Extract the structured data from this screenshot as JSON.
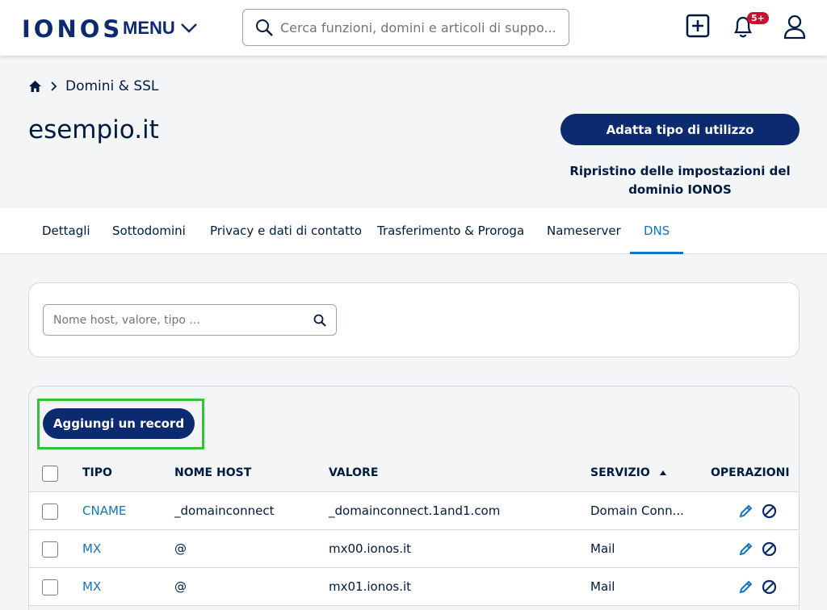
{
  "header": {
    "logo": "IONOS",
    "menu_label": "MENU",
    "search_placeholder": "Cerca funzioni, domini e articoli di suppo...",
    "notifications_badge": "5+"
  },
  "breadcrumb": {
    "label": "Domini & SSL"
  },
  "page": {
    "title": "esempio.it",
    "primary_button": "Adatta tipo di utilizzo",
    "reset_link_line1": "Ripristino delle impostazioni del",
    "reset_link_line2": "dominio IONOS"
  },
  "tabs": [
    {
      "label": "Dettagli"
    },
    {
      "label": "Sottodomini"
    },
    {
      "label": "Privacy e dati di contatto"
    },
    {
      "label": "Trasferimento & Proroga"
    },
    {
      "label": "Nameserver"
    },
    {
      "label": "DNS"
    }
  ],
  "filter": {
    "placeholder": "Nome host, valore, tipo ..."
  },
  "records": {
    "add_button": "Aggiungi un record",
    "columns": {
      "tipo": "TIPO",
      "nome_host": "NOME HOST",
      "valore": "VALORE",
      "servizio": "SERVIZIO",
      "operazioni": "OPERAZIONI"
    },
    "rows": [
      {
        "tipo": "CNAME",
        "host": "_domainconnect",
        "valore": "_domainconnect.1and1.com",
        "servizio": "Domain Conn..."
      },
      {
        "tipo": "MX",
        "host": "@",
        "valore": "mx00.ionos.it",
        "servizio": "Mail"
      },
      {
        "tipo": "MX",
        "host": "@",
        "valore": "mx01.ionos.it",
        "servizio": "Mail"
      }
    ]
  },
  "colors": {
    "brand": "#0b2a6f",
    "link": "#1474c4",
    "highlight": "#35c235",
    "badge": "#c8102e"
  }
}
